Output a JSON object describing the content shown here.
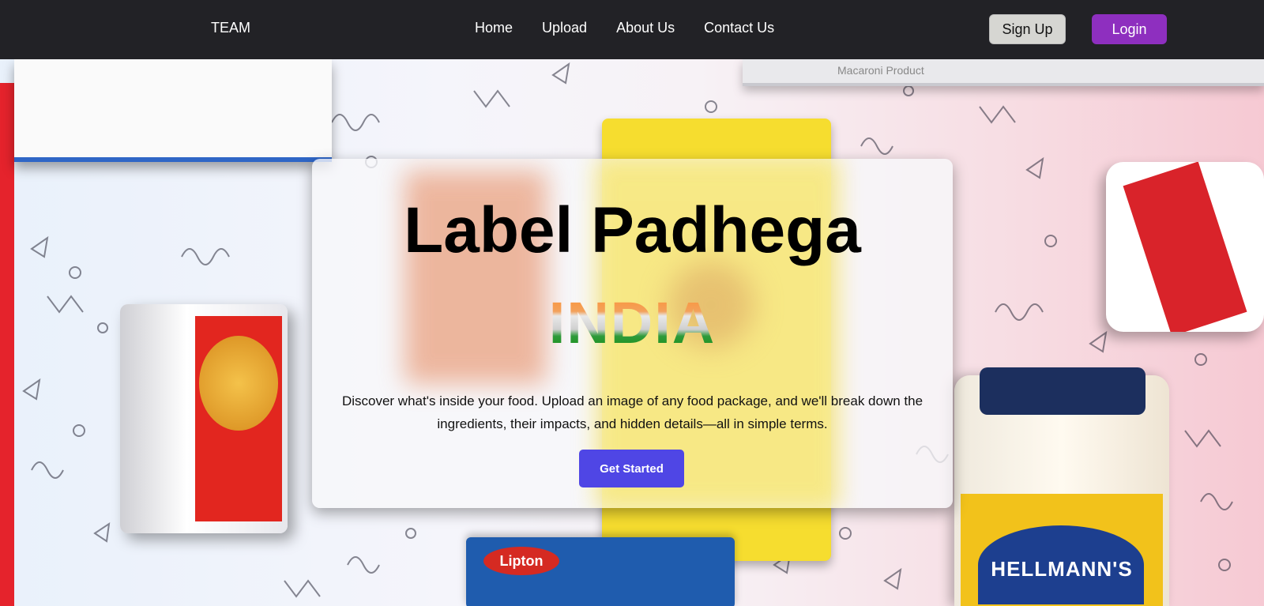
{
  "navbar": {
    "brand": "TEAM",
    "links": [
      "Home",
      "Upload",
      "About Us",
      "Contact Us"
    ],
    "signup_label": "Sign Up",
    "login_label": "Login",
    "login_color": "#8e2fbf"
  },
  "hero": {
    "title": "Label Padhega",
    "subtitle": "INDIA",
    "description": "Discover what's inside your food. Upload an image of any food package, and we'll break down the ingredients, their impacts, and hidden details—all in simple terms.",
    "cta_label": "Get Started",
    "cta_color": "#4f46e5"
  },
  "background": {
    "macaroni_text": "Macaroni Product",
    "mayo_brand": "HELLMANN'S",
    "lipton_brand": "Lipton"
  }
}
